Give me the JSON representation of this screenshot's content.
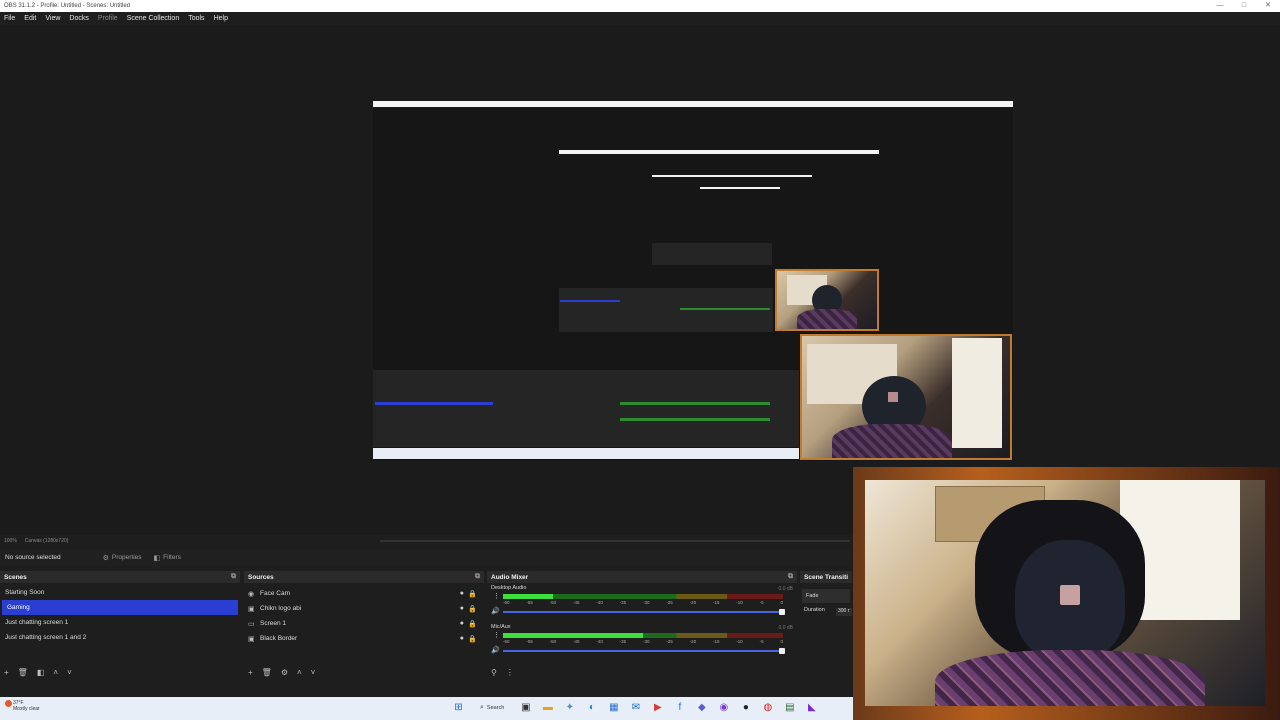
{
  "window": {
    "title": "OBS 31.1.2 - Profile: Untitled - Scenes: Untitled",
    "minimize": "—",
    "maximize": "□",
    "close": "✕"
  },
  "menu": {
    "file": "File",
    "edit": "Edit",
    "view": "View",
    "docks": "Docks",
    "profile": "Profile",
    "scene_collection": "Scene Collection",
    "tools": "Tools",
    "help": "Help"
  },
  "preview_status": {
    "zoom": "100%",
    "canvas": "Canvas (1280x720)"
  },
  "context_bar": {
    "no_source": "No source selected",
    "properties": "Properties",
    "filters": "Filters"
  },
  "scenes": {
    "title": "Scenes",
    "items": [
      "Starting Soon",
      "Gaming",
      "Just chatting screen 1",
      "Just chatting screen 1 and 2"
    ],
    "selected": "Gaming"
  },
  "sources": {
    "title": "Sources",
    "items": [
      {
        "label": "Face Cam",
        "icon": "camera-icon"
      },
      {
        "label": "Chikn logo abi",
        "icon": "image-icon"
      },
      {
        "label": "Screen 1",
        "icon": "monitor-icon"
      },
      {
        "label": "Black Border",
        "icon": "image-icon"
      }
    ]
  },
  "mixer": {
    "title": "Audio Mixer",
    "channels": [
      {
        "name": "Desktop Audio",
        "db": "0.0 dB",
        "level": 0.18
      },
      {
        "name": "Mic/Aux",
        "db": "0.0 dB",
        "level": 0.5
      }
    ],
    "ticks": [
      "-60",
      "-55",
      "-50",
      "-45",
      "-40",
      "-35",
      "-30",
      "-25",
      "-20",
      "-15",
      "-10",
      "-5",
      "0"
    ]
  },
  "transitions": {
    "title": "Scene Transiti",
    "type": "Fade",
    "duration_label": "Duration",
    "duration_value": "300 r"
  },
  "taskbar": {
    "weather_temp": "37°F",
    "weather_desc": "Mostly clear",
    "search": "Search"
  },
  "colors": {
    "selected_scene": "#2a3fd1",
    "meter_green": "#3ee03e",
    "volume_slider": "#4a63e0"
  }
}
